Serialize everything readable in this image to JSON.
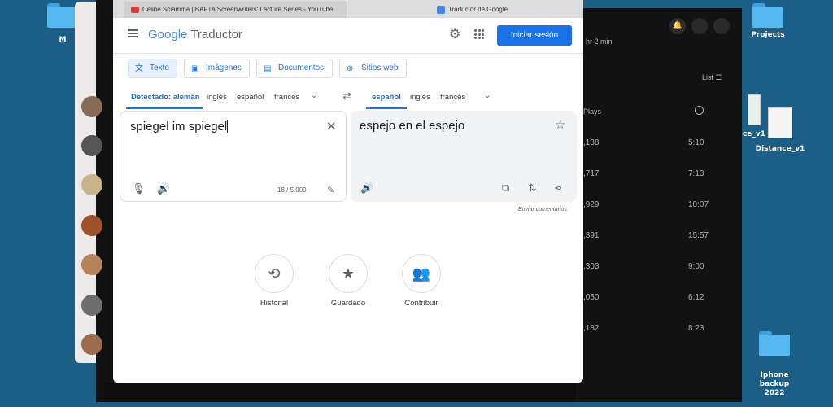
{
  "desktop": {
    "icons": [
      {
        "label": "M"
      },
      {
        "label": "Projects"
      },
      {
        "label": "ce_v1"
      },
      {
        "label": "Distance_v1"
      },
      {
        "label": "Iphone backup\n2022"
      }
    ]
  },
  "dark_app": {
    "header_text": "hr 2 min",
    "list_label": "List",
    "plays_header": "Plays",
    "rows": [
      {
        "plays": ",138",
        "duration": "5:10"
      },
      {
        "plays": ",717",
        "duration": "7:13"
      },
      {
        "plays": ",929",
        "duration": "10:07"
      },
      {
        "plays": ",391",
        "duration": "15:57"
      },
      {
        "plays": ",303",
        "duration": "9:00"
      },
      {
        "plays": ",050",
        "duration": "6:12"
      },
      {
        "plays": ",182",
        "duration": "8:23"
      }
    ]
  },
  "tabs": [
    {
      "title": "Céline Sciamma | BAFTA Screenwriters' Lecture Series - YouTube"
    },
    {
      "title": "Traductor de Google"
    }
  ],
  "header": {
    "logo_google": "Google",
    "logo_product": "Traductor",
    "signin": "Iniciar sesión"
  },
  "modes": [
    {
      "label": "Texto",
      "icon": "translate-icon"
    },
    {
      "label": "Imágenes",
      "icon": "image-icon"
    },
    {
      "label": "Documentos",
      "icon": "document-icon"
    },
    {
      "label": "Sitios web",
      "icon": "globe-icon"
    }
  ],
  "source_langs": [
    "Detectado: alemán",
    "inglés",
    "español",
    "francés"
  ],
  "target_langs": [
    "español",
    "inglés",
    "francés"
  ],
  "source": {
    "text": "spiegel im spiegel",
    "counter": "18 / 5.000"
  },
  "target": {
    "text": "espejo en el espejo"
  },
  "feedback": "Enviar comentarios",
  "shortcuts": [
    {
      "label": "Historial",
      "icon": "history-icon"
    },
    {
      "label": "Guardado",
      "icon": "star-icon"
    },
    {
      "label": "Contribuir",
      "icon": "people-icon"
    }
  ],
  "colors": {
    "accent": "#1a73e8",
    "desktop": "#1c5f86"
  }
}
